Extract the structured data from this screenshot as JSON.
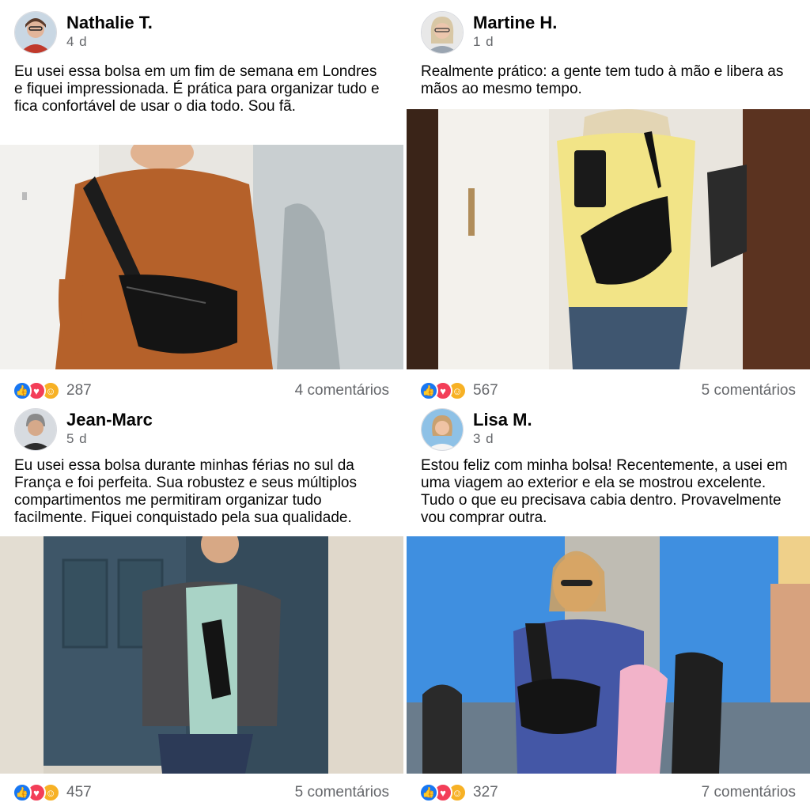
{
  "posts": [
    {
      "author": "Nathalie T.",
      "time": "4 d",
      "text": "Eu usei essa bolsa em um fim de semana em Londres e fiquei impressionada. É prática para organizar tudo e fica confortável de usar o dia todo. Sou fã.",
      "reaction_count": "287",
      "comments": "4 comentários",
      "reactions": [
        "like-icon",
        "love-icon",
        "care-icon"
      ]
    },
    {
      "author": "Martine H.",
      "time": "1 d",
      "text": "Realmente prático: a gente tem tudo à mão e libera as mãos ao mesmo tempo.",
      "reaction_count": "567",
      "comments": "5 comentários",
      "reactions": [
        "like-icon",
        "love-icon",
        "care-icon"
      ]
    },
    {
      "author": "Jean-Marc",
      "time": "5 d",
      "text": "Eu usei essa bolsa durante minhas férias no sul da França e foi perfeita. Sua robustez e seus múltiplos compartimentos me permitiram organizar tudo facilmente. Fiquei conquistado pela sua qualidade.",
      "reaction_count": "457",
      "comments": "5 comentários",
      "reactions": [
        "like-icon",
        "love-icon",
        "care-icon"
      ]
    },
    {
      "author": "Lisa M.",
      "time": "3 d",
      "text": "Estou feliz com minha bolsa! Recentemente, a usei em uma viagem ao exterior e ela se mostrou excelente. Tudo o que eu precisava cabia dentro. Provavelmente vou comprar outra.",
      "reaction_count": "327",
      "comments": "7 comentários",
      "reactions": [
        "like-icon",
        "love-icon",
        "care-icon"
      ]
    }
  ],
  "colors": {
    "like": "#1877f2",
    "love": "#f33e58",
    "care": "#f7b125",
    "secondary_text": "#65676b"
  }
}
